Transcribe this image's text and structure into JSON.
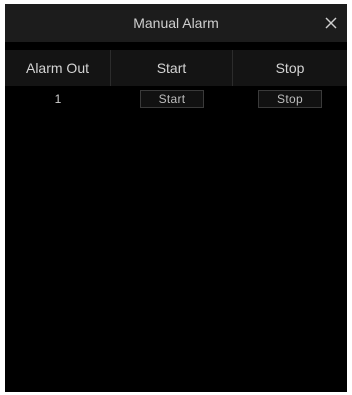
{
  "dialog": {
    "title": "Manual Alarm",
    "close_icon": "close-icon"
  },
  "table": {
    "columns": [
      "Alarm Out",
      "Start",
      "Stop"
    ],
    "rows": [
      {
        "alarm_out": "1",
        "start_label": "Start",
        "stop_label": "Stop"
      }
    ]
  },
  "colors": {
    "background": "#000000",
    "titlebar": "#1c1c1c",
    "header": "#141414",
    "text": "#d9d9d9"
  }
}
